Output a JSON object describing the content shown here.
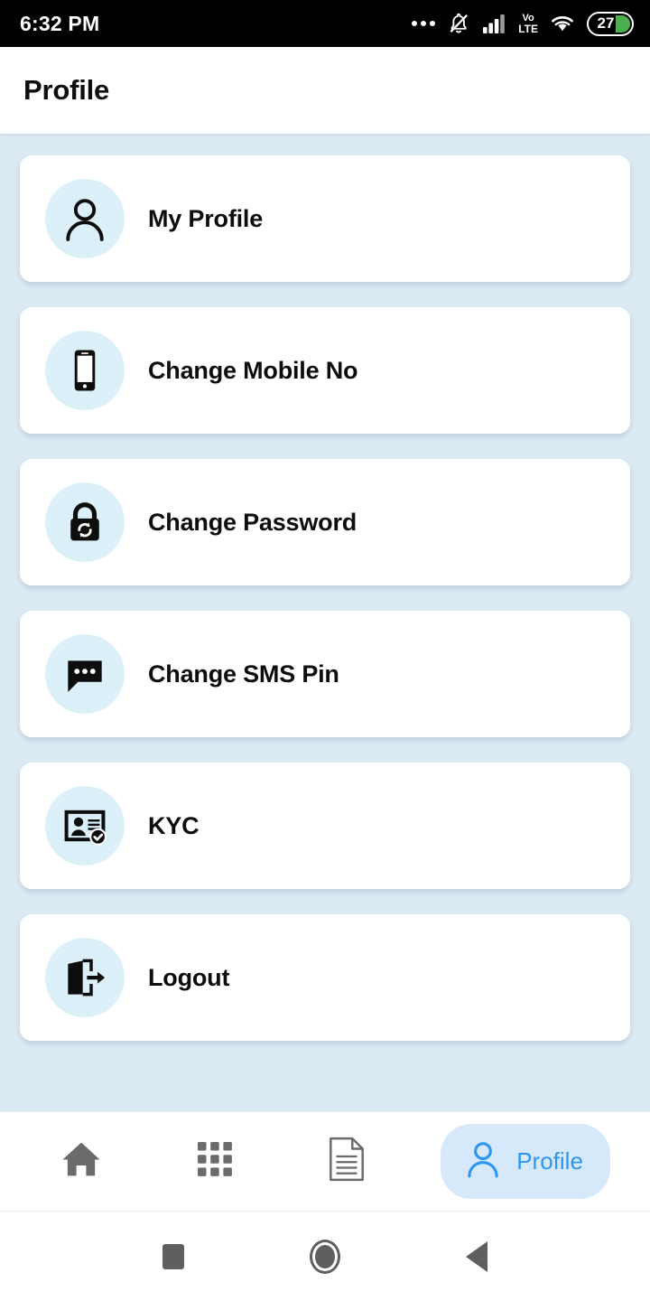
{
  "status_bar": {
    "time": "6:32 PM",
    "icons": [
      "more-dots-icon",
      "bell-muted-icon",
      "signal-bars-icon",
      "volte-icon",
      "wifi-icon",
      "battery-icon"
    ],
    "volte_top": "Vo",
    "volte_bottom": "LTE",
    "battery_percent": "27",
    "battery_fill_color": "#4caf50"
  },
  "app_bar": {
    "title": "Profile"
  },
  "theme": {
    "page_background": "#dceaf4",
    "card_background": "#ffffff",
    "icon_circle": "#dcf0fa",
    "accent": "#2d96f0",
    "active_pill": "#d6e9fb",
    "text": "#0d0d0d",
    "nav_inactive": "#6b6b6b"
  },
  "menu": {
    "items": [
      {
        "label": "My Profile",
        "icon": "person-outline-icon"
      },
      {
        "label": "Change Mobile No",
        "icon": "smartphone-icon"
      },
      {
        "label": "Change Password",
        "icon": "lock-refresh-icon"
      },
      {
        "label": "Change SMS Pin",
        "icon": "chat-bubble-dots-icon"
      },
      {
        "label": "KYC",
        "icon": "id-card-verified-icon"
      },
      {
        "label": "Logout",
        "icon": "exit-door-arrow-icon"
      }
    ]
  },
  "bottom_nav": {
    "items": [
      {
        "label": "",
        "icon": "home-icon",
        "active": false
      },
      {
        "label": "",
        "icon": "grid-apps-icon",
        "active": false
      },
      {
        "label": "",
        "icon": "document-icon",
        "active": false
      },
      {
        "label": "Profile",
        "icon": "person-outline-icon",
        "active": true
      }
    ],
    "active_label": "Profile"
  },
  "android_nav": {
    "items": [
      "recents-square-icon",
      "home-circle-icon",
      "back-triangle-icon"
    ]
  }
}
